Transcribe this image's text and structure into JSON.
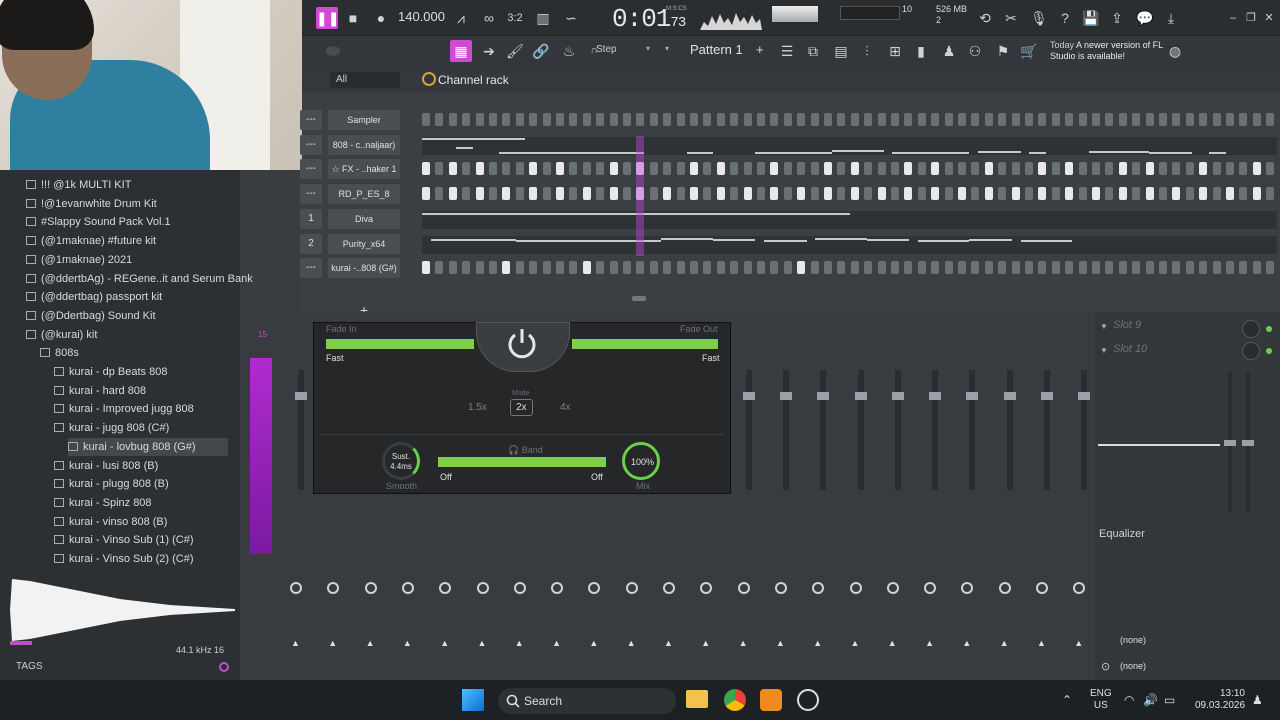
{
  "transport": {
    "bpm": "140.000",
    "time_main": "0:01",
    "time_sub": "73",
    "time_unit": "M:S:CS",
    "mem": "526 MB",
    "mem_sub": "2",
    "cpu": "10"
  },
  "toolbar": {
    "snap_label": "Step",
    "pattern_label": "Pattern 1",
    "news_date": "Today",
    "news_text": "A newer version of FL Studio is available!"
  },
  "channel_rack": {
    "filter": "All",
    "title": "Channel rack",
    "channels": [
      {
        "name": "Sampler",
        "num": "---",
        "type": "steps",
        "pattern": [
          0,
          0,
          0,
          0,
          0,
          0,
          0,
          0,
          0,
          0,
          0,
          0,
          0,
          0,
          0,
          0,
          0,
          0,
          0,
          0,
          0,
          0,
          0,
          0,
          0,
          0,
          0,
          0,
          0,
          0,
          0,
          0,
          0,
          0,
          0,
          0,
          0,
          0,
          0,
          0,
          0,
          0,
          0,
          0,
          0,
          0,
          0,
          0,
          0,
          0,
          0,
          0,
          0,
          0,
          0,
          0,
          0,
          0,
          0,
          0,
          0,
          0,
          0,
          0
        ]
      },
      {
        "name": "808 - c..naljaar)",
        "num": "---",
        "type": "roll"
      },
      {
        "name": "☆ FX - ..haker 1",
        "num": "---",
        "type": "steps",
        "pattern": [
          1,
          0,
          1,
          0,
          1,
          0,
          0,
          0,
          1,
          0,
          1,
          0,
          0,
          0,
          1,
          0,
          1,
          0,
          0,
          0,
          1,
          0,
          1,
          0,
          0,
          0,
          1,
          0,
          0,
          0,
          1,
          0,
          1,
          0,
          0,
          0,
          1,
          0,
          1,
          0,
          0,
          0,
          1,
          0,
          0,
          0,
          1,
          0,
          1,
          0,
          0,
          0,
          1,
          0,
          1,
          0,
          0,
          0,
          1,
          0,
          0,
          0,
          1,
          0
        ]
      },
      {
        "name": "RD_P_ES_8",
        "num": "---",
        "type": "steps",
        "pattern": [
          1,
          0,
          1,
          0,
          1,
          0,
          1,
          0,
          1,
          0,
          1,
          0,
          1,
          0,
          1,
          0,
          1,
          0,
          1,
          0,
          1,
          0,
          1,
          0,
          1,
          0,
          1,
          0,
          1,
          0,
          1,
          0,
          1,
          0,
          1,
          0,
          1,
          0,
          1,
          0,
          1,
          0,
          1,
          0,
          1,
          0,
          1,
          0,
          1,
          0,
          1,
          0,
          1,
          0,
          1,
          0,
          1,
          0,
          1,
          0,
          1,
          0,
          1,
          0
        ]
      },
      {
        "name": "Diva",
        "num": "1",
        "type": "roll"
      },
      {
        "name": "Purity_x64",
        "num": "2",
        "type": "roll"
      },
      {
        "name": "kurai -..808 (G#)",
        "num": "---",
        "type": "steps",
        "pattern": [
          1,
          0,
          0,
          0,
          0,
          0,
          1,
          0,
          0,
          0,
          0,
          0,
          1,
          0,
          0,
          0,
          0,
          0,
          0,
          0,
          0,
          0,
          0,
          0,
          0,
          0,
          0,
          0,
          1,
          0,
          0,
          0,
          0,
          0,
          0,
          0,
          0,
          0,
          0,
          0,
          0,
          0,
          0,
          0,
          0,
          0,
          0,
          0,
          0,
          0,
          0,
          0,
          0,
          0,
          0,
          0,
          0,
          0,
          0,
          0,
          0,
          0,
          0,
          0
        ]
      }
    ]
  },
  "browser": {
    "items": [
      {
        "label": "!!! @1k MULTI KIT",
        "indent": 1,
        "kind": "folder"
      },
      {
        "label": "!@1evanwhite Drum Kit",
        "indent": 1,
        "kind": "folder"
      },
      {
        "label": "#Slappy Sound Pack Vol.1",
        "indent": 1,
        "kind": "folder"
      },
      {
        "label": "(@1maknae) #future kit",
        "indent": 1,
        "kind": "folder"
      },
      {
        "label": "(@1maknae) 2021",
        "indent": 1,
        "kind": "folder"
      },
      {
        "label": "(@ddertbAg) - REGene..it and Serum Bank",
        "indent": 1,
        "kind": "folder"
      },
      {
        "label": "(@ddertbag) passport kit",
        "indent": 1,
        "kind": "folder"
      },
      {
        "label": "(@Ddertbag) Sound Kit",
        "indent": 1,
        "kind": "folder"
      },
      {
        "label": "(@kurai) kit",
        "indent": 1,
        "kind": "folder"
      },
      {
        "label": "808s",
        "indent": 2,
        "kind": "folder"
      },
      {
        "label": "kurai - dp Beats 808",
        "indent": 3,
        "kind": "file"
      },
      {
        "label": "kurai - hard 808",
        "indent": 3,
        "kind": "file"
      },
      {
        "label": "kurai - Improved jugg 808",
        "indent": 3,
        "kind": "file"
      },
      {
        "label": "kurai - jugg 808 (C#)",
        "indent": 3,
        "kind": "file"
      },
      {
        "label": "kurai - lovbug 808 (G#)",
        "indent": 4,
        "kind": "file",
        "selected": true
      },
      {
        "label": "kurai - lusi 808 (B)",
        "indent": 3,
        "kind": "file"
      },
      {
        "label": "kurai - plugg 808 (B)",
        "indent": 3,
        "kind": "file"
      },
      {
        "label": "kurai - Spinz 808",
        "indent": 3,
        "kind": "file"
      },
      {
        "label": "kurai - vinso 808 (B)",
        "indent": 3,
        "kind": "file"
      },
      {
        "label": "kurai - Vinso Sub (1) (C#)",
        "indent": 3,
        "kind": "file"
      },
      {
        "label": "kurai - Vinso Sub (2) (C#)",
        "indent": 3,
        "kind": "file"
      }
    ],
    "sample_rate": "44.1 kHz 16",
    "tags_label": "TAGS"
  },
  "plugin": {
    "fade_in_label": "Fade In",
    "fade_out_label": "Fade Out",
    "fade_in_value": "Fast",
    "fade_out_value": "Fast",
    "mode_label": "Mode",
    "modes": [
      "1.5x",
      "2x",
      "4x"
    ],
    "smooth_value": "Sust. 4.4ms",
    "smooth_label": "Smooth",
    "band_label": "Band",
    "band_left": "Off",
    "band_right": "Off",
    "mix_value": "100%",
    "mix_label": "Mix"
  },
  "mixer": {
    "level_label": "15",
    "slots": [
      "Slot 9",
      "Slot 10"
    ],
    "eq_label": "Equalizer",
    "out_none_1": "(none)",
    "out_none_2": "(none)"
  },
  "taskbar": {
    "search_label": "Search",
    "lang": "ENG",
    "region": "US",
    "time": "13:10",
    "date": "09.03.2026"
  },
  "colors": {
    "accent": "#d04ad4",
    "green": "#7ed04a",
    "bg": "#3a3d40"
  }
}
